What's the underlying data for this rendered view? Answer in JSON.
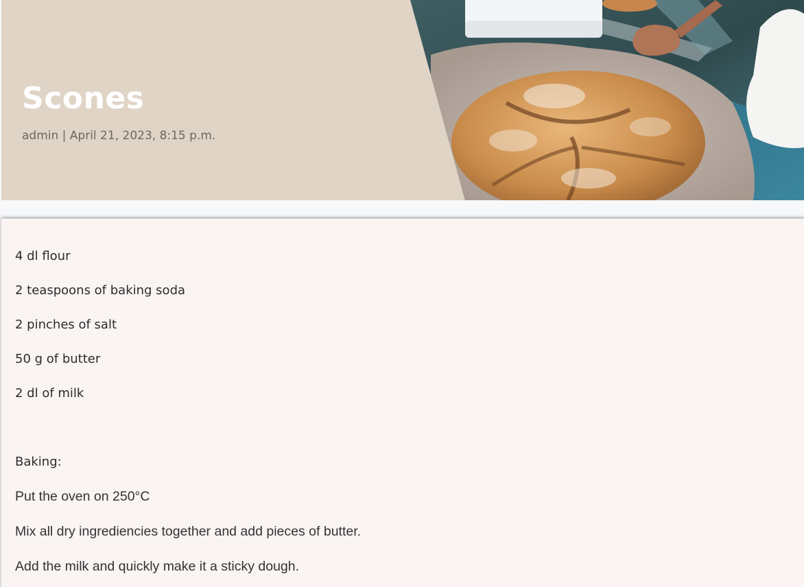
{
  "post": {
    "title": "Scones",
    "meta": "admin | April 21, 2023, 8:15 p.m.",
    "image": {
      "description_icon": "scones-bread-photo"
    }
  },
  "content": {
    "ingredients": [
      "4 dl flour",
      "2 teaspoons of baking soda",
      "2 pinches of salt",
      "50 g of butter",
      "2 dl of milk"
    ],
    "section_label": "Baking:",
    "steps": [
      "Put the oven on 250°C",
      "Mix all dry ingrediencies together and add pieces of butter.",
      "Add the milk and quickly make it a sticky dough."
    ]
  },
  "colors": {
    "hero_background": "#e0d4c6",
    "card_background": "#faf4f3",
    "title_color": "#ffffff"
  }
}
